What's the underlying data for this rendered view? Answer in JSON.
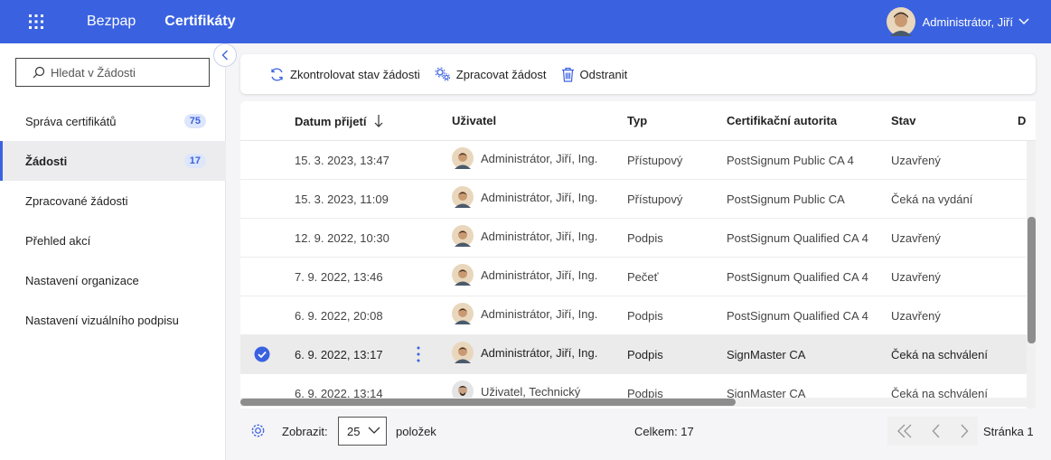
{
  "topbar": {
    "brand": "Bezpap",
    "section": "Certifikáty",
    "user_name": "Administrátor, Jiří"
  },
  "sidebar": {
    "search_placeholder": "Hledat v Žádosti",
    "items": [
      {
        "label": "Správa certifikátů",
        "badge": "75"
      },
      {
        "label": "Žádosti",
        "badge": "17"
      },
      {
        "label": "Zpracované žádosti"
      },
      {
        "label": "Přehled akcí"
      },
      {
        "label": "Nastavení organizace"
      },
      {
        "label": "Nastavení vizuálního podpisu"
      }
    ]
  },
  "toolbar": {
    "check_status": "Zkontrolovat stav žádosti",
    "process": "Zpracovat žádost",
    "delete": "Odstranit"
  },
  "table": {
    "columns": {
      "date": "Datum přijetí",
      "user": "Uživatel",
      "type": "Typ",
      "ca": "Certifikační autorita",
      "status": "Stav",
      "next": "D"
    },
    "rows": [
      {
        "date": "15. 3. 2023, 13:47",
        "user": "Administrátor, Jiří, Ing.",
        "type": "Přístupový",
        "ca": "PostSignum Public CA 4",
        "status": "Uzavřený"
      },
      {
        "date": "15. 3. 2023, 11:09",
        "user": "Administrátor, Jiří, Ing.",
        "type": "Přístupový",
        "ca": "PostSignum Public CA",
        "status": "Čeká na vydání"
      },
      {
        "date": "12. 9. 2022, 10:30",
        "user": "Administrátor, Jiří, Ing.",
        "type": "Podpis",
        "ca": "PostSignum Qualified CA 4",
        "status": "Uzavřený"
      },
      {
        "date": "7. 9. 2022, 13:46",
        "user": "Administrátor, Jiří, Ing.",
        "type": "Pečeť",
        "ca": "PostSignum Qualified CA 4",
        "status": "Uzavřený"
      },
      {
        "date": "6. 9. 2022, 20:08",
        "user": "Administrátor, Jiří, Ing.",
        "type": "Podpis",
        "ca": "PostSignum Qualified CA 4",
        "status": "Uzavřený"
      },
      {
        "date": "6. 9. 2022, 13:17",
        "user": "Administrátor, Jiří, Ing.",
        "type": "Podpis",
        "ca": "SignMaster CA",
        "status": "Čeká na schválení",
        "selected": true
      },
      {
        "date": "6. 9. 2022, 13:14",
        "user": "Uživatel, Technický",
        "type": "Podpis",
        "ca": "SignMaster CA",
        "status": "Čeká na schválení"
      }
    ]
  },
  "footer": {
    "show_label": "Zobrazit:",
    "page_size": "25",
    "items_label": "položek",
    "total": "Celkem: 17",
    "page_label": "Stránka 1"
  },
  "colors": {
    "accent": "#3a62e0",
    "badge_bg": "#dde6fb",
    "selected_row": "#ebebeb"
  },
  "icons": {
    "apps": "grid-icon",
    "refresh": "refresh-icon",
    "process": "gears-icon",
    "delete": "trash-icon",
    "sort": "arrow-down-icon",
    "selected": "check-circle-icon",
    "row_menu": "kebab-icon",
    "settings": "gear-icon"
  }
}
